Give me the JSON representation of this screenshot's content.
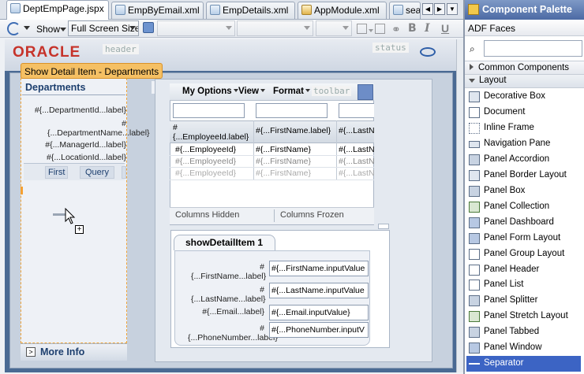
{
  "tabs": [
    {
      "label": "DeptEmpPage.jspx",
      "active": true
    },
    {
      "label": "EmpByEmail.xml",
      "active": false
    },
    {
      "label": "EmpDetails.xml",
      "active": false
    },
    {
      "label": "AppModule.xml",
      "active": false
    },
    {
      "label": "searc",
      "active": false
    }
  ],
  "toolbar": {
    "show_label": "Show",
    "screen_size": "Full Screen Size"
  },
  "canvas": {
    "brand": "ORACLE",
    "header_facet": "header",
    "status_facet": "status",
    "detail_tooltip": "Show Detail Item - Departments",
    "departments": {
      "title": "Departments",
      "fields": [
        "#{...DepartmentId...label}",
        "#{...DepartmentName...label}",
        "#{...ManagerId...label}",
        "#{...LocationId...label}"
      ],
      "buttons": [
        "First",
        "Query"
      ]
    },
    "more_info": "More Info",
    "employees_toolbar": {
      "menus": [
        "My Options",
        "View",
        "Format"
      ],
      "toolbar_facet": "toolbar"
    },
    "table": {
      "columns": [
        "#{...EmployeeId.label}",
        "#{...FirstName.label}",
        "#{...LastN"
      ],
      "rows": [
        [
          "#{...EmployeeId}",
          "#{...FirstName}",
          "#{...LastN"
        ],
        [
          "#{...EmployeeId}",
          "#{...FirstName}",
          "#{...LastN"
        ],
        [
          "#{...EmployeeId}",
          "#{...FirstName}",
          "#{...LastN"
        ]
      ],
      "footer": [
        "Columns Hidden",
        "Columns Frozen"
      ]
    },
    "show_detail_tab": "showDetailItem 1",
    "form": [
      {
        "label": "#{...FirstName...label}",
        "value": "#{...FirstName.inputValue"
      },
      {
        "label": "#{...LastName...label}",
        "value": "#{...LastName.inputValue"
      },
      {
        "label": "#{...Email...label}",
        "value": "#{...Email.inputValue}"
      },
      {
        "label": "#{...PhoneNumber...label}",
        "value": "#{...PhoneNumber.inputV"
      }
    ]
  },
  "palette": {
    "title": "Component Palette",
    "library": "ADF Faces",
    "sections": [
      "Common Components",
      "Layout"
    ],
    "items": [
      "Decorative Box",
      "Document",
      "Inline Frame",
      "Navigation Pane",
      "Panel Accordion",
      "Panel Border Layout",
      "Panel Box",
      "Panel Collection",
      "Panel Dashboard",
      "Panel Form Layout",
      "Panel Group Layout",
      "Panel Header",
      "Panel List",
      "Panel Splitter",
      "Panel Stretch Layout",
      "Panel Tabbed",
      "Panel Window",
      "Separator"
    ],
    "selected": "Separator"
  },
  "colors": {
    "oracle_red": "#c6332a",
    "detail_orange": "#f5b23a",
    "palette_header": "#5b7ab0",
    "selection_blue": "#3c64c4"
  }
}
